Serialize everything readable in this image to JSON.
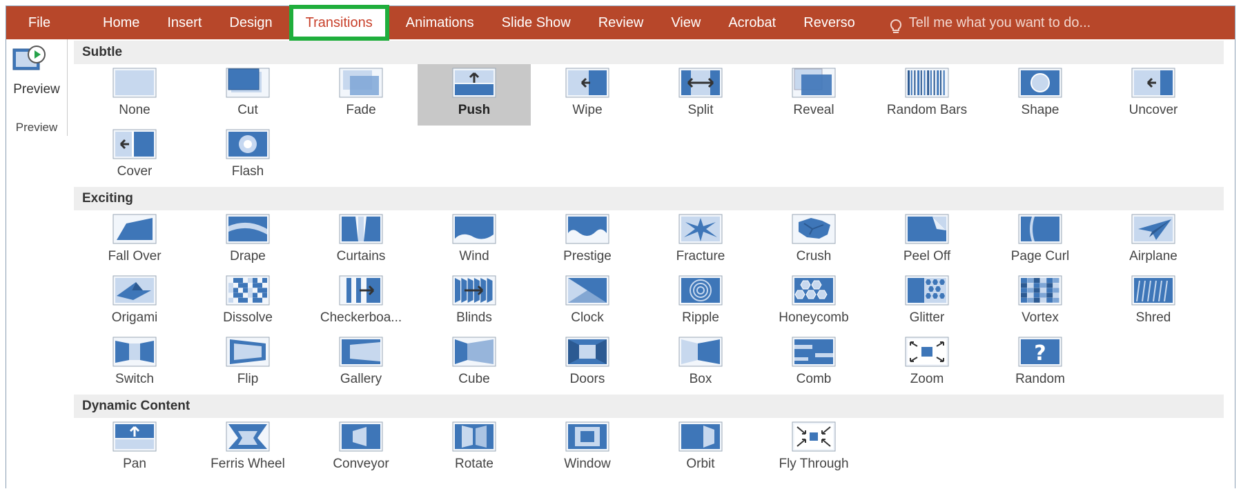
{
  "ribbon": {
    "file": "File",
    "tabs": [
      "Home",
      "Insert",
      "Design",
      "Transitions",
      "Animations",
      "Slide Show",
      "Review",
      "View",
      "Acrobat",
      "Reverso"
    ],
    "active_tab": "Transitions",
    "tell_me": "Tell me what you want to do..."
  },
  "preview": {
    "button_label": "Preview",
    "group_label": "Preview"
  },
  "sections": [
    {
      "title": "Subtle",
      "items": [
        {
          "label": "None",
          "icon": "none-icon"
        },
        {
          "label": "Cut",
          "icon": "cut-icon"
        },
        {
          "label": "Fade",
          "icon": "fade-icon"
        },
        {
          "label": "Push",
          "icon": "push-icon",
          "selected": true
        },
        {
          "label": "Wipe",
          "icon": "wipe-icon"
        },
        {
          "label": "Split",
          "icon": "split-icon"
        },
        {
          "label": "Reveal",
          "icon": "reveal-icon"
        },
        {
          "label": "Random Bars",
          "icon": "random-bars-icon"
        },
        {
          "label": "Shape",
          "icon": "shape-icon"
        },
        {
          "label": "Uncover",
          "icon": "uncover-icon"
        },
        {
          "label": "Cover",
          "icon": "cover-icon"
        },
        {
          "label": "Flash",
          "icon": "flash-icon"
        }
      ]
    },
    {
      "title": "Exciting",
      "items": [
        {
          "label": "Fall Over",
          "icon": "fall-over-icon"
        },
        {
          "label": "Drape",
          "icon": "drape-icon"
        },
        {
          "label": "Curtains",
          "icon": "curtains-icon"
        },
        {
          "label": "Wind",
          "icon": "wind-icon"
        },
        {
          "label": "Prestige",
          "icon": "prestige-icon"
        },
        {
          "label": "Fracture",
          "icon": "fracture-icon"
        },
        {
          "label": "Crush",
          "icon": "crush-icon"
        },
        {
          "label": "Peel Off",
          "icon": "peel-off-icon"
        },
        {
          "label": "Page Curl",
          "icon": "page-curl-icon"
        },
        {
          "label": "Airplane",
          "icon": "airplane-icon"
        },
        {
          "label": "Origami",
          "icon": "origami-icon"
        },
        {
          "label": "Dissolve",
          "icon": "dissolve-icon"
        },
        {
          "label": "Checkerboa...",
          "icon": "checkerboard-icon"
        },
        {
          "label": "Blinds",
          "icon": "blinds-icon"
        },
        {
          "label": "Clock",
          "icon": "clock-icon"
        },
        {
          "label": "Ripple",
          "icon": "ripple-icon"
        },
        {
          "label": "Honeycomb",
          "icon": "honeycomb-icon"
        },
        {
          "label": "Glitter",
          "icon": "glitter-icon"
        },
        {
          "label": "Vortex",
          "icon": "vortex-icon"
        },
        {
          "label": "Shred",
          "icon": "shred-icon"
        },
        {
          "label": "Switch",
          "icon": "switch-icon"
        },
        {
          "label": "Flip",
          "icon": "flip-icon"
        },
        {
          "label": "Gallery",
          "icon": "gallery-icon"
        },
        {
          "label": "Cube",
          "icon": "cube-icon"
        },
        {
          "label": "Doors",
          "icon": "doors-icon"
        },
        {
          "label": "Box",
          "icon": "box-icon"
        },
        {
          "label": "Comb",
          "icon": "comb-icon"
        },
        {
          "label": "Zoom",
          "icon": "zoom-icon"
        },
        {
          "label": "Random",
          "icon": "random-icon"
        }
      ]
    },
    {
      "title": "Dynamic Content",
      "items": [
        {
          "label": "Pan",
          "icon": "pan-icon"
        },
        {
          "label": "Ferris Wheel",
          "icon": "ferris-wheel-icon"
        },
        {
          "label": "Conveyor",
          "icon": "conveyor-icon"
        },
        {
          "label": "Rotate",
          "icon": "rotate-icon"
        },
        {
          "label": "Window",
          "icon": "window-icon"
        },
        {
          "label": "Orbit",
          "icon": "orbit-icon"
        },
        {
          "label": "Fly Through",
          "icon": "fly-through-icon"
        }
      ]
    }
  ],
  "colors": {
    "ribbon": "#b7472a",
    "active_tab_text": "#c8402a",
    "highlight_box": "#1fae3c",
    "icon_blue": "#3e76b8",
    "icon_light": "#c7d8ee",
    "selected_bg": "#c8c8c8"
  }
}
